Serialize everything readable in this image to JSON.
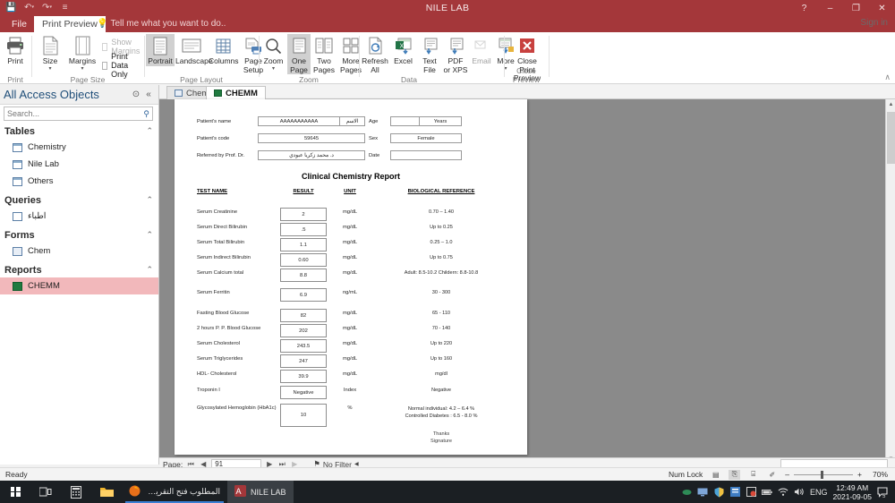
{
  "window": {
    "title": "NILE LAB",
    "sign_in": "Sign in",
    "help_icon": "?",
    "minimize_icon": "–",
    "restore_icon": "❐",
    "close_icon": "✕"
  },
  "quick_access": [
    {
      "name": "save-icon",
      "glyph": "💾"
    },
    {
      "name": "undo-icon",
      "glyph": "↶"
    },
    {
      "name": "redo-icon",
      "glyph": "↷"
    },
    {
      "name": "customize-qat-icon",
      "glyph": "≡"
    }
  ],
  "ribbon": {
    "tabs": [
      {
        "label": "File",
        "active": false
      },
      {
        "label": "Print Preview",
        "active": true
      }
    ],
    "tell_me": "Tell me what you want to do..",
    "groups": [
      {
        "label": "Print"
      },
      {
        "label": "Page Size"
      },
      {
        "label": "Page Layout"
      },
      {
        "label": "Zoom"
      },
      {
        "label": "Data"
      },
      {
        "label": "Close Preview"
      }
    ],
    "buttons": {
      "print": "Print",
      "size": "Size",
      "margins": "Margins",
      "show_margins": "Show Margins",
      "print_data_only": "Print Data Only",
      "portrait": "Portrait",
      "landscape": "Landscape",
      "columns": "Columns",
      "page_setup_l1": "Page",
      "page_setup_l2": "Setup",
      "zoom": "Zoom",
      "one_page_l1": "One",
      "one_page_l2": "Page",
      "two_pages_l1": "Two",
      "two_pages_l2": "Pages",
      "more_pages_l1": "More",
      "more_pages_l2": "Pages",
      "refresh_l1": "Refresh",
      "refresh_l2": "All",
      "excel": "Excel",
      "text_file_l1": "Text",
      "text_file_l2": "File",
      "pdf_l1": "PDF",
      "pdf_l2": "or XPS",
      "email": "Email",
      "more_l1": "More",
      "close_preview_l1": "Close Print",
      "close_preview_l2": "Preview"
    },
    "collapse_icon": "∧"
  },
  "nav_pane": {
    "title": "All Access Objects",
    "filter_icon": "⊙",
    "collapse_icon": "«",
    "search_placeholder": "Search...",
    "search_value": "",
    "search_icon": "⚲",
    "groups": [
      {
        "label": "Tables",
        "chevron": "⌃",
        "items": [
          {
            "label": "Chemistry",
            "icon": "table-icon",
            "selected": false
          },
          {
            "label": "Nile Lab",
            "icon": "table-icon",
            "selected": false
          },
          {
            "label": "Others",
            "icon": "table-icon",
            "selected": false
          }
        ]
      },
      {
        "label": "Queries",
        "chevron": "⌃",
        "items": [
          {
            "label": "اطباء",
            "icon": "query-icon",
            "selected": false
          }
        ]
      },
      {
        "label": "Forms",
        "chevron": "⌃",
        "items": [
          {
            "label": "Chem",
            "icon": "form-icon",
            "selected": false
          }
        ]
      },
      {
        "label": "Reports",
        "chevron": "⌃",
        "items": [
          {
            "label": "CHEMM",
            "icon": "report-icon",
            "selected": true
          }
        ]
      }
    ]
  },
  "doc_tabs": [
    {
      "label": "Chem",
      "icon": "form-icon",
      "active": false
    },
    {
      "label": "CHEMM",
      "icon": "report-icon",
      "active": true
    }
  ],
  "report": {
    "title": "Clinical Chemistry Report",
    "header_fields": {
      "patient_name_label": "Patient's name",
      "patient_name_value": "AAAAAAAAAAA",
      "patient_name_arabic": "الاسم",
      "patient_code_label": "Patient's code",
      "patient_code_value": "59645",
      "referred_by_label": "Referred by Prof. Dr.",
      "referred_by_value": "د. محمد زكريا عبودي",
      "age_label": "Age",
      "age_value": "",
      "age_unit": "Years",
      "sex_label": "Sex",
      "sex_value": "Female",
      "date_label": "Date",
      "date_value": ""
    },
    "columns": [
      "TEST NAME",
      "RESULT",
      "UNIT",
      "BIOLOGICAL REFERENCE"
    ],
    "rows": [
      {
        "test": "Serum Creatinine",
        "result": "2",
        "unit": "mg/dL",
        "reference": "0.70 – 1.40"
      },
      {
        "test": "Serum Direct Bilirubin",
        "result": ".5",
        "unit": "mg/dL",
        "reference": "Up to 0.25"
      },
      {
        "test": "Serum Total Bilirubin",
        "result": "1.1",
        "unit": "mg/dL",
        "reference": "0.25 – 1.0"
      },
      {
        "test": "Serum Indirect Bilirubin",
        "result": "0.60",
        "unit": "mg/dL",
        "reference": "Up to 0.75"
      },
      {
        "test": "Serum Calcium total",
        "result": "8.8",
        "unit": "mg/dL",
        "reference": "Adult: 8.5-10.2 Childern: 8.8-10.8"
      },
      {
        "test": "Serum Ferritin",
        "result": "6.9",
        "unit": "ng/mL",
        "reference": "30 - 300"
      },
      {
        "test": "Fasting Blood Glucose",
        "result": "82",
        "unit": "mg/dL",
        "reference": "65  -  110"
      },
      {
        "test": "2 hours P. P. Blood Glucose",
        "result": "202",
        "unit": "mg/dL",
        "reference": "70 - 140"
      },
      {
        "test": "Serum Cholesterol",
        "result": "243.5",
        "unit": "mg/dL",
        "reference": "Up to 220"
      },
      {
        "test": "Serum Triglycerides",
        "result": "247",
        "unit": "mg/dL",
        "reference": "Up to 160"
      },
      {
        "test": "HDL- Cholesterol",
        "result": "39.9",
        "unit": "mg/dL",
        "reference": "mg/dl"
      },
      {
        "test": "Troponin I",
        "result": "Negative",
        "unit": "Index",
        "reference": "Negative"
      },
      {
        "test": "Glycosylated Hemoglobin (HbA1c)",
        "result": "10",
        "unit": "%",
        "reference": "Normal individual: 4.2 – 6.4 %\nControlled Diabetes  : 6.5 -  8.0 %"
      }
    ],
    "footer_line1": "Thanks",
    "footer_line2": "Signature"
  },
  "record_nav": {
    "page_label": "Page:",
    "page_value": "91",
    "first_icon": "⏮",
    "prev_icon": "◀",
    "next_icon": "▶",
    "last_icon": "⏭",
    "new_icon": "▶",
    "filter_icon": "⚑",
    "filter_label": "No Filter",
    "filter_caret": "◀"
  },
  "status_bar": {
    "ready": "Ready",
    "num_lock": "Num Lock",
    "views": [
      {
        "name": "report-view-button",
        "glyph": "▤",
        "active": false
      },
      {
        "name": "print-preview-button",
        "glyph": "⎘",
        "active": true
      },
      {
        "name": "layout-view-button",
        "glyph": "⌸",
        "active": false
      },
      {
        "name": "design-view-button",
        "glyph": "✐",
        "active": false
      }
    ],
    "zoom_out": "–",
    "zoom_in": "+",
    "zoom_percent": "70%"
  },
  "taskbar": {
    "start_icon": "windows-logo",
    "task_view_icon": "⌸",
    "calculator_icon": "⌸",
    "explorer_icon": "folder-icon",
    "apps": [
      {
        "label": "المطلوب فتح التقرير...",
        "icon": "firefox-icon",
        "active": false,
        "accent": "#3b7fd4"
      },
      {
        "label": "NILE LAB",
        "icon": "access-icon",
        "active": true,
        "accent": "#a4373a"
      }
    ],
    "tray_icons": [
      "◉",
      "▣",
      "⛉",
      "▥",
      "▨",
      "▭",
      "⌇",
      "🔊"
    ],
    "language": "ENG",
    "time": "12:49 AM",
    "date": "2021-09-05",
    "notification_count": "5"
  },
  "colors": {
    "accent": "#a4373a",
    "selection": "#f2b8bb",
    "canvas": "#8a8a8a",
    "taskbar": "#1b1f23"
  }
}
